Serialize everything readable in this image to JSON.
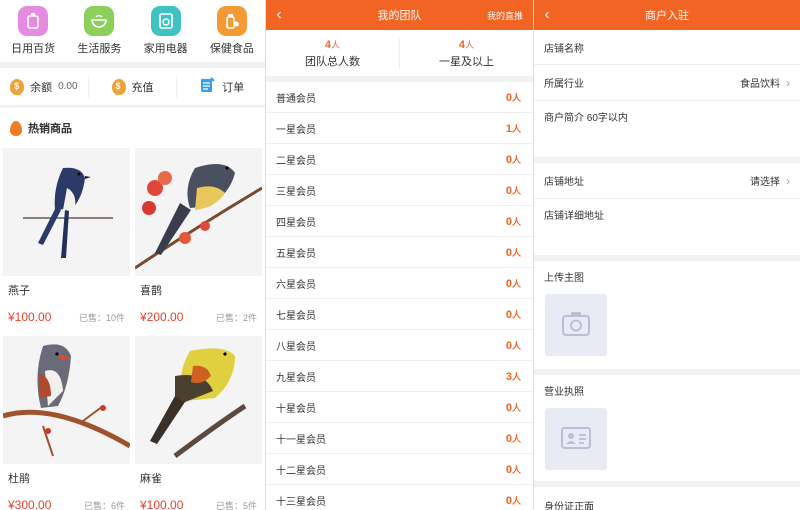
{
  "shop": {
    "categories": [
      {
        "label": "日用百货",
        "icon": "daily-goods-icon",
        "color": "#e58be0"
      },
      {
        "label": "生活服务",
        "icon": "life-service-icon",
        "color": "#8bd05a"
      },
      {
        "label": "家用电器",
        "icon": "appliance-icon",
        "color": "#3fc2c0"
      },
      {
        "label": "保健食品",
        "icon": "health-food-icon",
        "color": "#f39a35"
      }
    ],
    "account": {
      "balance_label": "余额",
      "balance_value": "0.00",
      "recharge_label": "充值",
      "orders_label": "订单"
    },
    "hot_title": "热销商品",
    "products": [
      {
        "name": "燕子",
        "price": "¥100.00",
        "sold": "已售：10件"
      },
      {
        "name": "喜鹊",
        "price": "¥200.00",
        "sold": "已售：2件"
      },
      {
        "name": "杜鹃",
        "price": "¥300.00",
        "sold": "已售：6件"
      },
      {
        "name": "麻雀",
        "price": "¥100.00",
        "sold": "已售：5件"
      }
    ]
  },
  "team": {
    "title": "我的团队",
    "right_link": "我的直推",
    "stats": [
      {
        "num": "4",
        "unit": "人",
        "label": "团队总人数"
      },
      {
        "num": "4",
        "unit": "人",
        "label": "一星及以上"
      }
    ],
    "unit": "人",
    "members": [
      {
        "label": "普通会员",
        "count": "0"
      },
      {
        "label": "一星会员",
        "count": "1"
      },
      {
        "label": "二星会员",
        "count": "0"
      },
      {
        "label": "三星会员",
        "count": "0"
      },
      {
        "label": "四星会员",
        "count": "0"
      },
      {
        "label": "五星会员",
        "count": "0"
      },
      {
        "label": "六星会员",
        "count": "0"
      },
      {
        "label": "七星会员",
        "count": "0"
      },
      {
        "label": "八星会员",
        "count": "0"
      },
      {
        "label": "九星会员",
        "count": "3"
      },
      {
        "label": "十星会员",
        "count": "0"
      },
      {
        "label": "十一星会员",
        "count": "0"
      },
      {
        "label": "十二星会员",
        "count": "0"
      },
      {
        "label": "十三星会员",
        "count": "0"
      }
    ]
  },
  "merchant": {
    "title": "商户入驻",
    "shop_name_label": "店铺名称",
    "industry_label": "所属行业",
    "industry_value": "食品饮料",
    "intro_label": "商户简介 60字以内",
    "address_label": "店铺地址",
    "address_value": "请选择",
    "detail_address_label": "店铺详细地址",
    "main_image_label": "上传主图",
    "license_label": "营业执照",
    "id_front_label": "身份证正面"
  },
  "colors": {
    "accent": "#f16424",
    "price": "#e8412a"
  }
}
